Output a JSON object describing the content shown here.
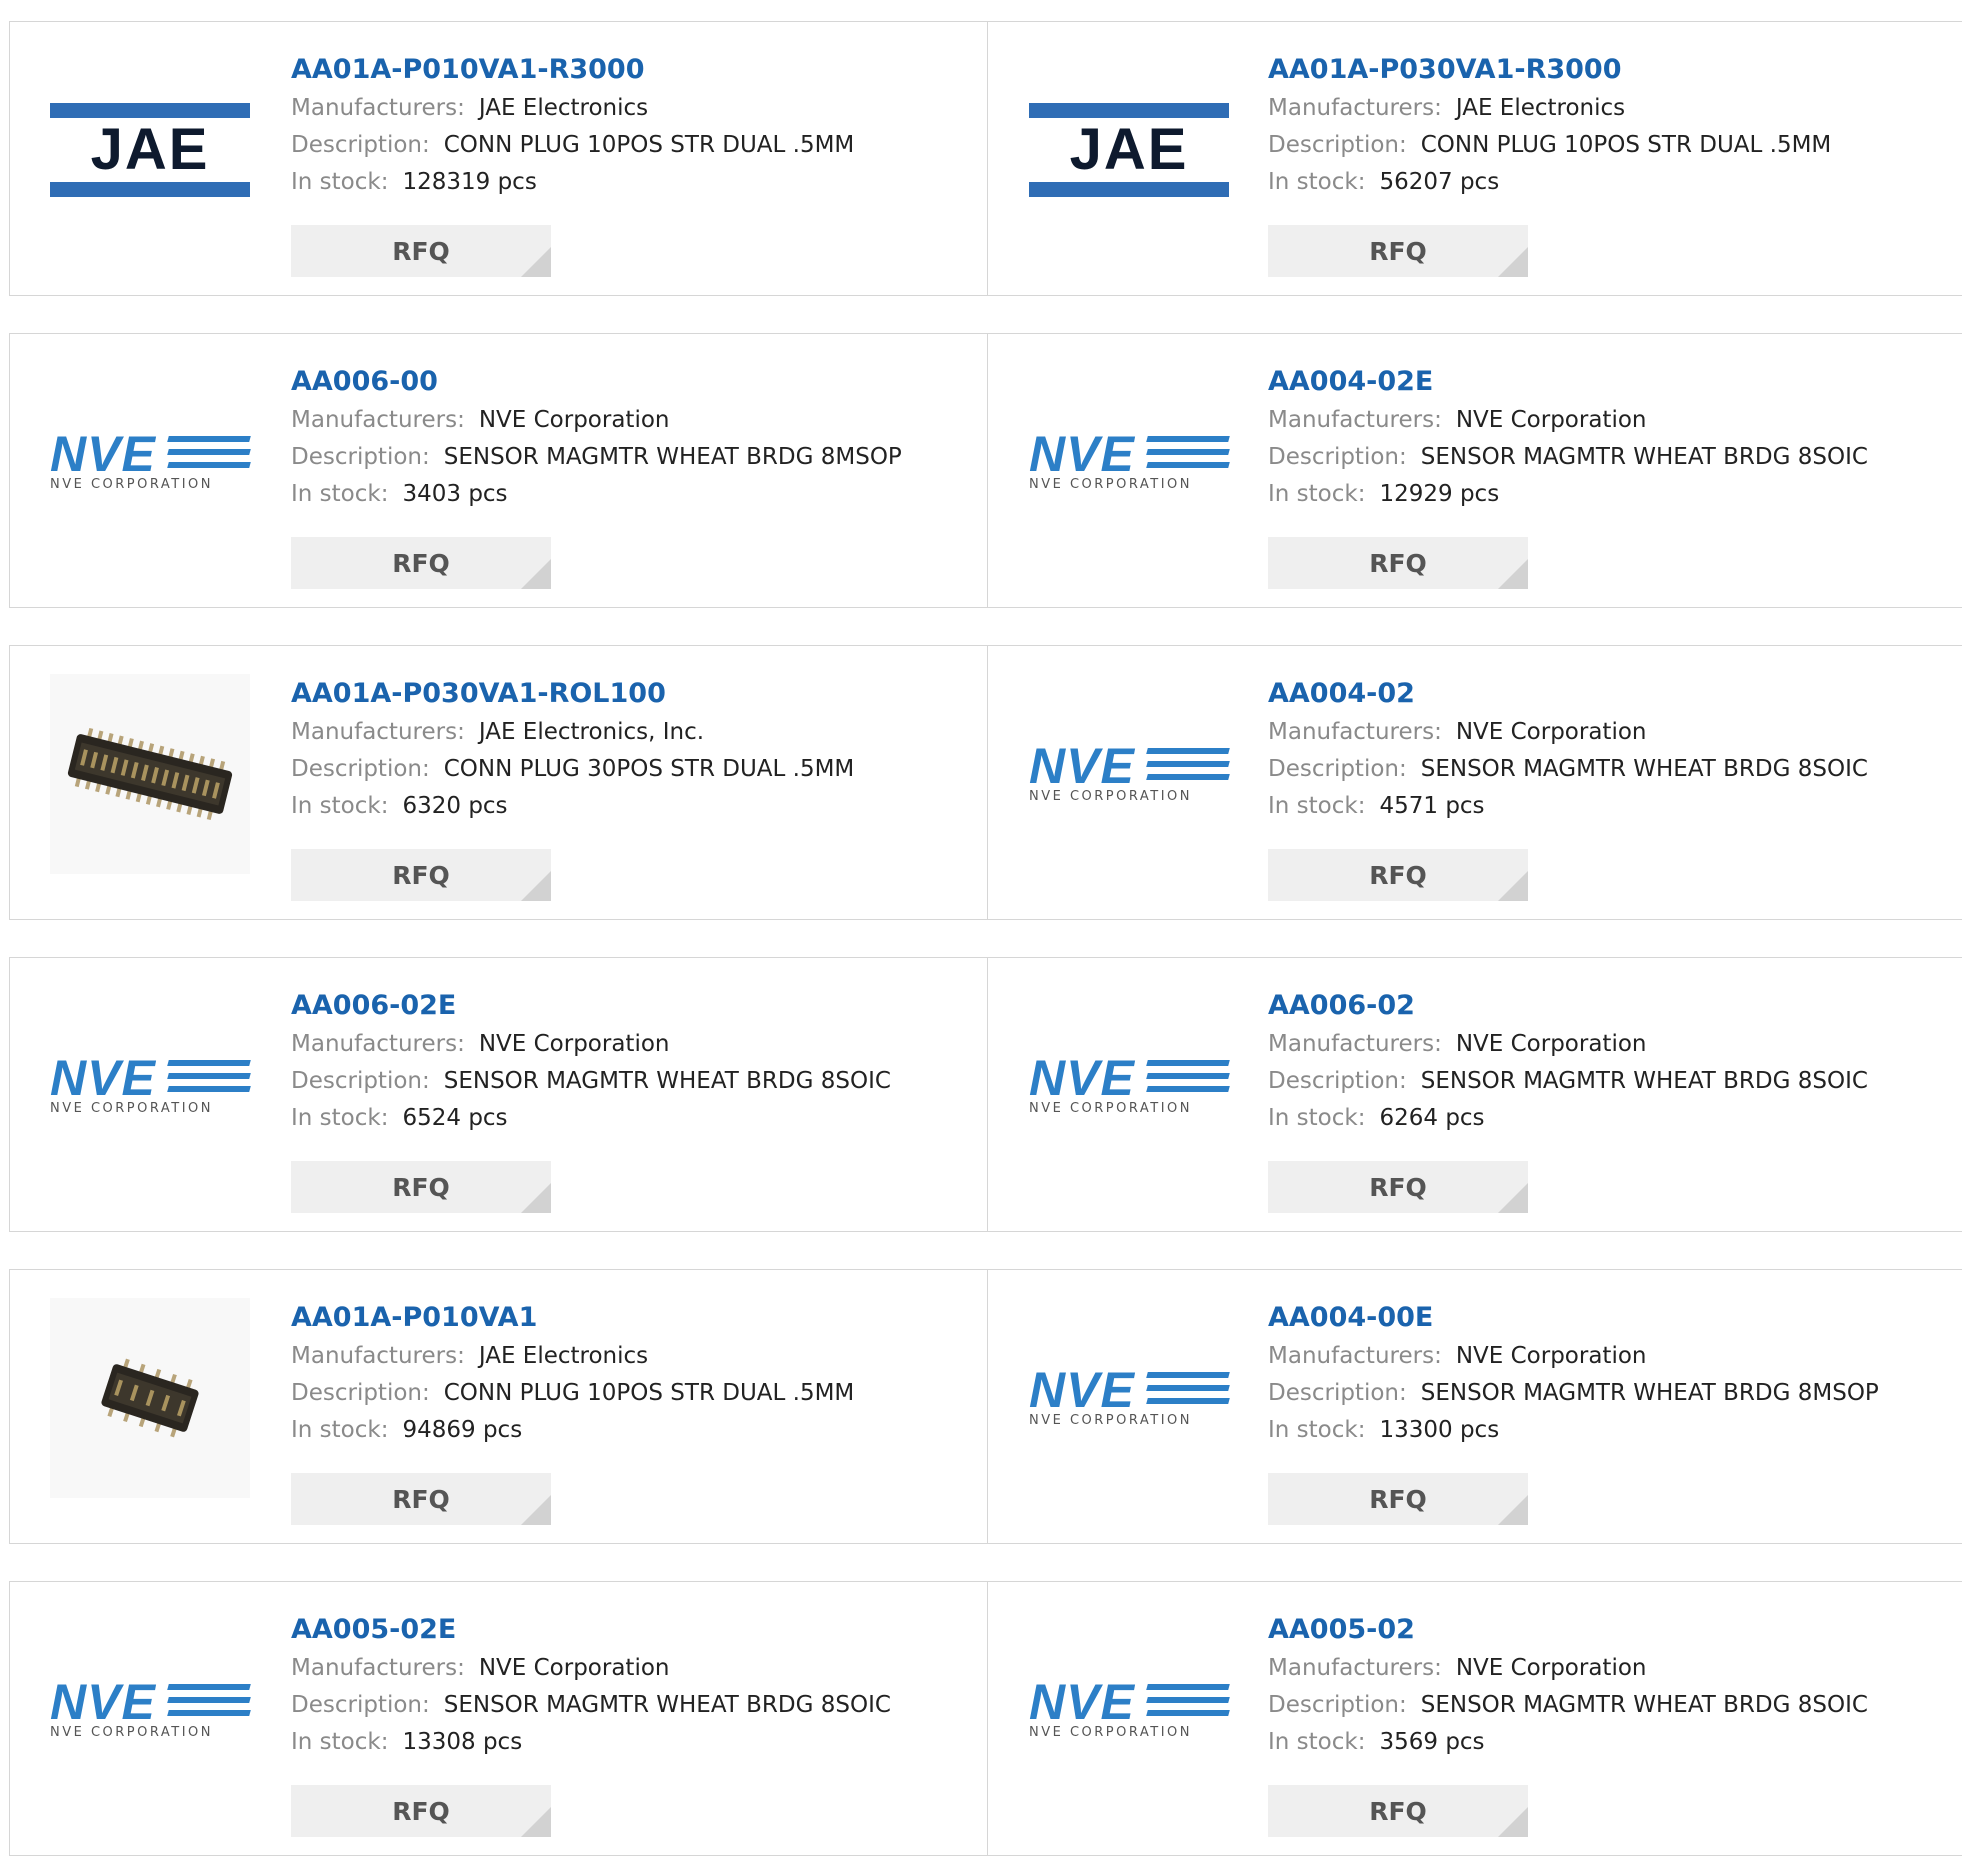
{
  "labels": {
    "manufacturers": "Manufacturers:",
    "description": "Description:",
    "in_stock": "In stock:",
    "rfq": "RFQ"
  },
  "colors": {
    "link": "#1a63ad",
    "jae_blue": "#2f6db5",
    "nve_blue": "#2c7fc7"
  },
  "logo_text": {
    "jae": "JAE",
    "nve": "NVE",
    "nve_sub": "NVE CORPORATION"
  },
  "products": [
    {
      "part": "AA01A-P010VA1-R3000",
      "logo": "jae",
      "manufacturer": "JAE Electronics",
      "description": "CONN PLUG 10POS STR DUAL .5MM",
      "stock": "128319 pcs"
    },
    {
      "part": "AA01A-P030VA1-R3000",
      "logo": "jae",
      "manufacturer": "JAE Electronics",
      "description": "CONN PLUG 10POS STR DUAL .5MM",
      "stock": "56207 pcs"
    },
    {
      "part": "AA006-00",
      "logo": "nve",
      "manufacturer": "NVE Corporation",
      "description": "SENSOR MAGMTR WHEAT BRDG 8MSOP",
      "stock": "3403 pcs"
    },
    {
      "part": "AA004-02E",
      "logo": "nve",
      "manufacturer": "NVE Corporation",
      "description": "SENSOR MAGMTR WHEAT BRDG 8SOIC",
      "stock": "12929 pcs"
    },
    {
      "part": "AA01A-P030VA1-ROL100",
      "logo": "connector-photo-wide",
      "manufacturer": "JAE Electronics, Inc.",
      "description": "CONN PLUG 30POS STR DUAL .5MM",
      "stock": "6320 pcs"
    },
    {
      "part": "AA004-02",
      "logo": "nve",
      "manufacturer": "NVE Corporation",
      "description": "SENSOR MAGMTR WHEAT BRDG 8SOIC",
      "stock": "4571 pcs"
    },
    {
      "part": "AA006-02E",
      "logo": "nve",
      "manufacturer": "NVE Corporation",
      "description": "SENSOR MAGMTR WHEAT BRDG 8SOIC",
      "stock": "6524 pcs"
    },
    {
      "part": "AA006-02",
      "logo": "nve",
      "manufacturer": "NVE Corporation",
      "description": "SENSOR MAGMTR WHEAT BRDG 8SOIC",
      "stock": "6264 pcs"
    },
    {
      "part": "AA01A-P010VA1",
      "logo": "connector-photo-small",
      "manufacturer": "JAE Electronics",
      "description": "CONN PLUG 10POS STR DUAL .5MM",
      "stock": "94869 pcs"
    },
    {
      "part": "AA004-00E",
      "logo": "nve",
      "manufacturer": "NVE Corporation",
      "description": "SENSOR MAGMTR WHEAT BRDG 8MSOP",
      "stock": "13300 pcs"
    },
    {
      "part": "AA005-02E",
      "logo": "nve",
      "manufacturer": "NVE Corporation",
      "description": "SENSOR MAGMTR WHEAT BRDG 8SOIC",
      "stock": "13308 pcs"
    },
    {
      "part": "AA005-02",
      "logo": "nve",
      "manufacturer": "NVE Corporation",
      "description": "SENSOR MAGMTR WHEAT BRDG 8SOIC",
      "stock": "3569 pcs"
    }
  ]
}
